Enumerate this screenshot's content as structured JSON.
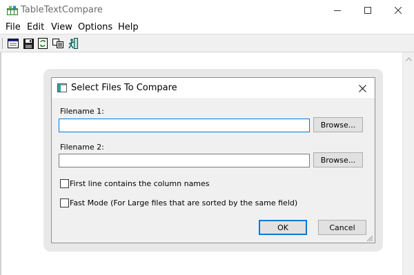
{
  "window": {
    "title": "TableTextCompare",
    "controls": {
      "minimize": "minimize-icon",
      "maximize": "maximize-icon",
      "close": "close-icon"
    }
  },
  "menu": {
    "items": [
      "File",
      "Edit",
      "View",
      "Options",
      "Help"
    ]
  },
  "toolbar": {
    "buttons": [
      "open-window-icon",
      "save-icon",
      "refresh-compare-icon",
      "copy-icon",
      "exit-icon"
    ]
  },
  "dialog": {
    "title": "Select Files To Compare",
    "filename1_label": "Filename 1:",
    "filename1_value": "",
    "filename2_label": "Filename 2:",
    "filename2_value": "",
    "browse1_label": "Browse...",
    "browse2_label": "Browse...",
    "first_line_label": "First line contains the column names",
    "first_line_checked": false,
    "fast_mode_label": "Fast Mode  (For Large files that are sorted by the same field)",
    "fast_mode_checked": false,
    "ok_label": "OK",
    "cancel_label": "Cancel"
  },
  "colors": {
    "accent": "#0078d7",
    "dialog_bg": "#f0f0f0",
    "button_bg": "#e1e1e1"
  }
}
